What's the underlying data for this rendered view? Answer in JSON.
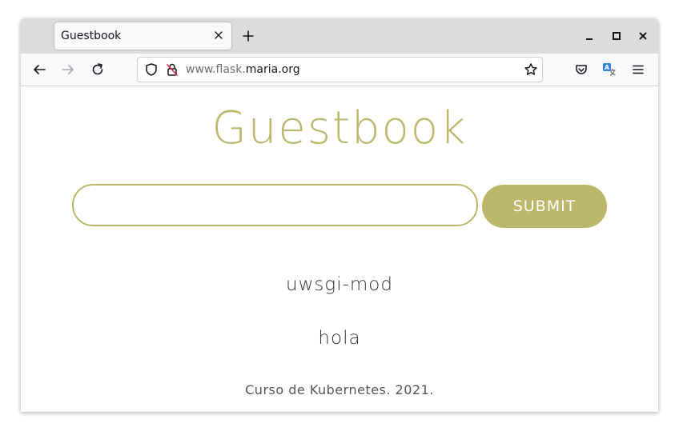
{
  "browser": {
    "tab": {
      "title": "Guestbook",
      "close_icon": "close-icon"
    },
    "new_tab_icon": "plus-icon",
    "window_controls": [
      "minimize-icon",
      "maximize-icon",
      "close-icon"
    ],
    "nav": {
      "back_icon": "arrow-left-icon",
      "forward_icon": "arrow-right-icon",
      "reload_icon": "reload-icon"
    },
    "url": {
      "prefix": "www.flask.",
      "domain": "maria.org"
    },
    "toolbar_icons": [
      "pocket-icon",
      "translate-icon",
      "menu-icon"
    ]
  },
  "page": {
    "title": "Guestbook",
    "input": {
      "value": "",
      "placeholder": ""
    },
    "submit_label": "SUBMIT",
    "entries": [
      "uwsgi-mod",
      "hola"
    ],
    "footer": "Curso de Kubernetes. 2021."
  },
  "colors": {
    "accent": "#bdb76b",
    "text": "#333333"
  }
}
